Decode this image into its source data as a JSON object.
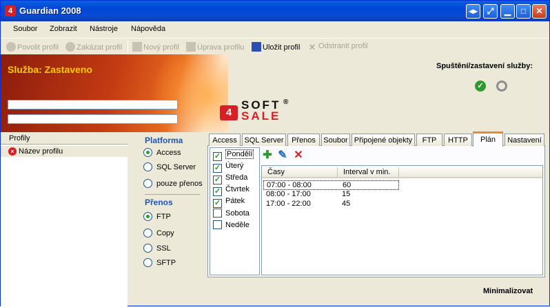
{
  "window": {
    "title": "Guardian 2008",
    "icon": "app-logo-icon",
    "controls": [
      "restore-tray-icon",
      "tray-icon",
      "minimize-icon",
      "maximize-icon",
      "close-icon"
    ],
    "control_glyphs": [
      "◂▸",
      "⤢",
      "▁",
      "□",
      "✕"
    ]
  },
  "menu": [
    "Soubor",
    "Zobrazit",
    "Nástroje",
    "Nápověda"
  ],
  "toolbar": [
    {
      "label": "Povolit profil",
      "enabled": false,
      "icon": "play-icon"
    },
    {
      "label": "Zakázat profil",
      "enabled": false,
      "icon": "disable-icon"
    },
    {
      "label": "Nový profil",
      "enabled": false,
      "icon": "plus-icon"
    },
    {
      "label": "Úprava profilu",
      "enabled": false,
      "icon": "edit-icon"
    },
    {
      "label": "Uložit profil",
      "enabled": true,
      "icon": "save-icon"
    },
    {
      "label": "Odstranit profil",
      "enabled": false,
      "icon": "delete-icon"
    }
  ],
  "banner": {
    "service_status": "Služba:  Zastaveno",
    "service_control_label": "Spuštění/zastavení služby:"
  },
  "logo": {
    "badge": "4",
    "line1": "SOFT",
    "line2": "SALE",
    "reg": "®"
  },
  "profiles": {
    "header": "Profily",
    "items": [
      "Název profilu"
    ]
  },
  "platform": {
    "title": "Platforma",
    "options": [
      "Access",
      "SQL Server",
      "pouze přenos"
    ],
    "selected": "Access"
  },
  "transfer": {
    "title": "Přenos",
    "options": [
      "FTP",
      "Copy",
      "SSL",
      "SFTP"
    ],
    "selected": "FTP"
  },
  "tabs": [
    "Access",
    "SQL Server",
    "Přenos",
    "Soubor",
    "Připojené objekty",
    "FTP",
    "HTTP",
    "Plán",
    "Nastavení"
  ],
  "active_tab": "Plán",
  "schedule": {
    "days": [
      {
        "label": "Pondělí",
        "checked": true
      },
      {
        "label": "Úterý",
        "checked": true
      },
      {
        "label": "Středa",
        "checked": true
      },
      {
        "label": "Čtvrtek",
        "checked": true
      },
      {
        "label": "Pátek",
        "checked": true
      },
      {
        "label": "Sobota",
        "checked": false
      },
      {
        "label": "Neděle",
        "checked": false
      }
    ],
    "tools": [
      {
        "glyph": "✚",
        "icon": "add-icon"
      },
      {
        "glyph": "✎",
        "icon": "edit-icon"
      },
      {
        "glyph": "✕",
        "icon": "delete-icon"
      }
    ],
    "columns": [
      "Časy",
      "Interval v min."
    ],
    "rows": [
      {
        "time": "07:00 - 08:00",
        "interval": "60"
      },
      {
        "time": "08:00 - 17:00",
        "interval": "15"
      },
      {
        "time": "17:00 - 22:00",
        "interval": "45"
      }
    ]
  },
  "footer": {
    "minimize": "Minimalizovat"
  },
  "colors": {
    "brand_red": "#d42026",
    "status_yellow": "#ffcc00",
    "start_green": "#2e9a2e",
    "stop_gray": "#8d8d8d",
    "group_blue": "#1f56b3",
    "tab_accent": "#e68b2c"
  }
}
